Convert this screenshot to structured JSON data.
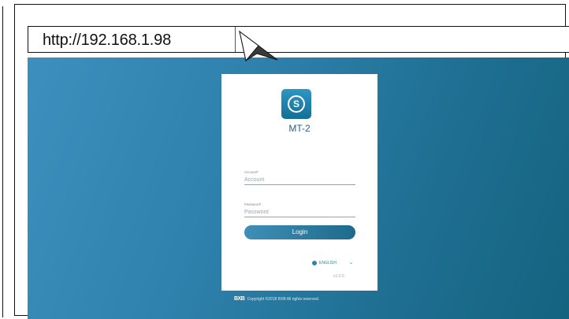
{
  "browser": {
    "url": "http://192.168.1.98"
  },
  "login": {
    "app_name": "MT-2",
    "account_label": "Account*",
    "account_placeholder": "Account",
    "password_label": "Password*",
    "password_placeholder": "Password",
    "login_button": "Login",
    "language": "ENGLISH",
    "version": "v1.0.0"
  },
  "footer": {
    "brand": "BXB",
    "copyright": "Copyright ©2018 BXB All rights reserved."
  },
  "icons": {
    "logo": "s-logo-icon",
    "language": "globe-icon",
    "dropdown": "chevron-down-icon",
    "pointer": "mouse-cursor-icon"
  },
  "colors": {
    "background_start": "#3d8fbd",
    "background_end": "#14637f",
    "accent": "#2f82ad"
  }
}
